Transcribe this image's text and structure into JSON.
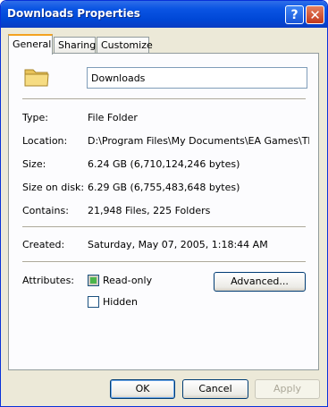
{
  "window": {
    "title": "Downloads Properties"
  },
  "tabs": [
    {
      "label": "General"
    },
    {
      "label": "Sharing"
    },
    {
      "label": "Customize"
    }
  ],
  "general": {
    "name": "Downloads",
    "type_label": "Type:",
    "type_value": "File Folder",
    "location_label": "Location:",
    "location_value": "D:\\Program Files\\My Documents\\EA Games\\The Si",
    "size_label": "Size:",
    "size_value": "6.24 GB (6,710,124,246 bytes)",
    "size_on_disk_label": "Size on disk:",
    "size_on_disk_value": "6.29 GB (6,755,483,648 bytes)",
    "contains_label": "Contains:",
    "contains_value": "21,948 Files, 225 Folders",
    "created_label": "Created:",
    "created_value": "Saturday, May 07, 2005, 1:18:44 AM",
    "attributes_label": "Attributes:",
    "readonly_label": "Read-only",
    "hidden_label": "Hidden",
    "advanced_label": "Advanced..."
  },
  "buttons": {
    "ok": "OK",
    "cancel": "Cancel",
    "apply": "Apply"
  },
  "icons": {
    "help": "help-icon",
    "close": "close-icon",
    "folder": "folder-icon"
  }
}
